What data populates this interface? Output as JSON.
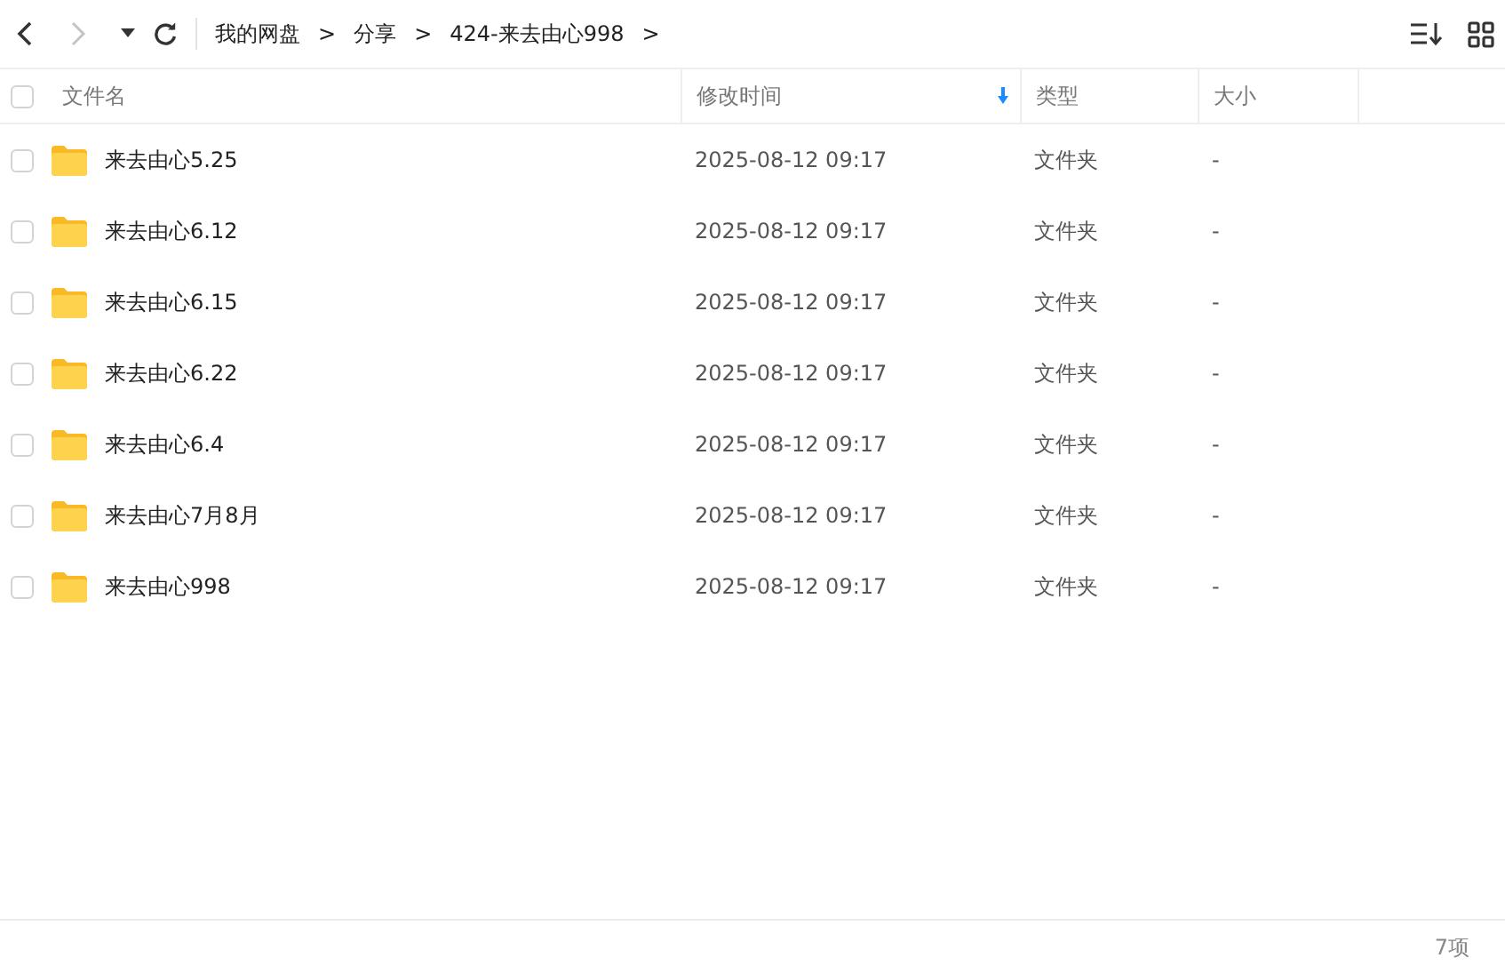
{
  "toolbar": {
    "back_disabled": false,
    "forward_disabled": true
  },
  "breadcrumb": [
    {
      "label": "我的网盘"
    },
    {
      "label": "分享"
    },
    {
      "label": "424-来去由心998"
    }
  ],
  "breadcrumb_separator": ">",
  "table": {
    "select_all_checked": false,
    "columns": [
      {
        "label": "文件名",
        "sorted": false
      },
      {
        "label": "修改时间",
        "sorted": true
      },
      {
        "label": "类型",
        "sorted": false
      },
      {
        "label": "大小",
        "sorted": false
      }
    ],
    "rows": [
      {
        "name": "来去由心5.25",
        "modified": "2025-08-12 09:17",
        "type": "文件夹",
        "size": "-",
        "checked": false
      },
      {
        "name": "来去由心6.12",
        "modified": "2025-08-12 09:17",
        "type": "文件夹",
        "size": "-",
        "checked": false
      },
      {
        "name": "来去由心6.15",
        "modified": "2025-08-12 09:17",
        "type": "文件夹",
        "size": "-",
        "checked": false
      },
      {
        "name": "来去由心6.22",
        "modified": "2025-08-12 09:17",
        "type": "文件夹",
        "size": "-",
        "checked": false
      },
      {
        "name": "来去由心6.4",
        "modified": "2025-08-12 09:17",
        "type": "文件夹",
        "size": "-",
        "checked": false
      },
      {
        "name": "来去由心7月8月",
        "modified": "2025-08-12 09:17",
        "type": "文件夹",
        "size": "-",
        "checked": false
      },
      {
        "name": "来去由心998",
        "modified": "2025-08-12 09:17",
        "type": "文件夹",
        "size": "-",
        "checked": false
      }
    ]
  },
  "status_bar": {
    "count": "7项"
  }
}
